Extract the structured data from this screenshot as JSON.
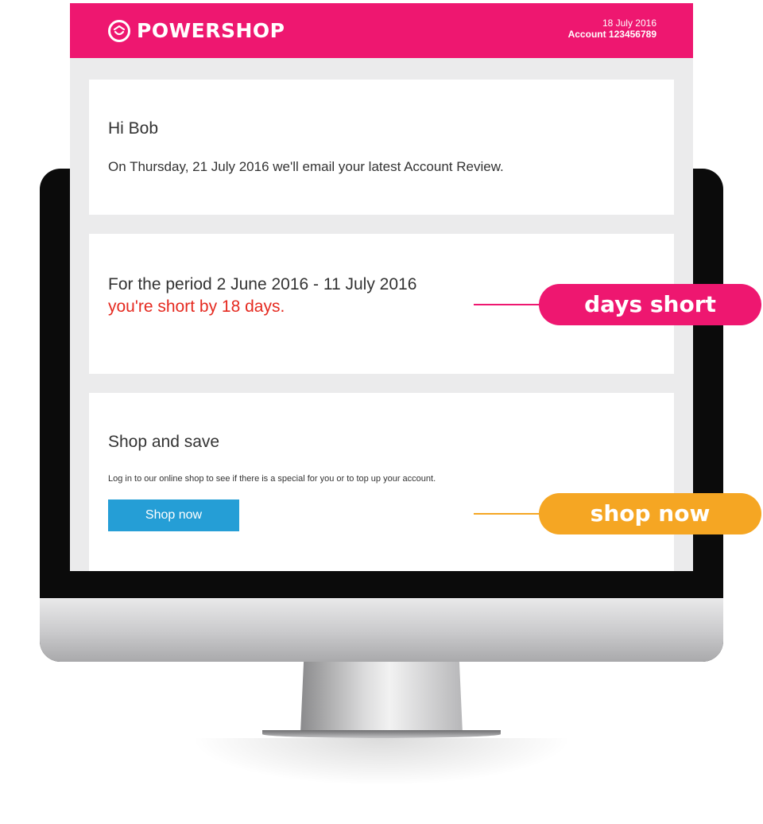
{
  "header": {
    "brand": "POWERSHOP",
    "date": "18 July 2016",
    "account": "Account 123456789",
    "background_color": "#ee1770"
  },
  "intro_card": {
    "greeting": "Hi Bob",
    "message": "On Thursday, 21 July 2016 we'll email your latest Account Review."
  },
  "period_card": {
    "period": "For the period 2 June 2016 - 11 July 2016",
    "status": "you're short by 18 days.",
    "status_color": "#e52a20"
  },
  "shop_card": {
    "title": "Shop and save",
    "description": "Log in to our online shop to see if there is a special for you or to top up your account.",
    "button_label": "Shop now",
    "button_color": "#259ed6"
  },
  "callouts": {
    "days_short": "days short",
    "shop_now": "shop now",
    "days_short_color": "#ee1770",
    "shop_now_color": "#f5a623"
  }
}
